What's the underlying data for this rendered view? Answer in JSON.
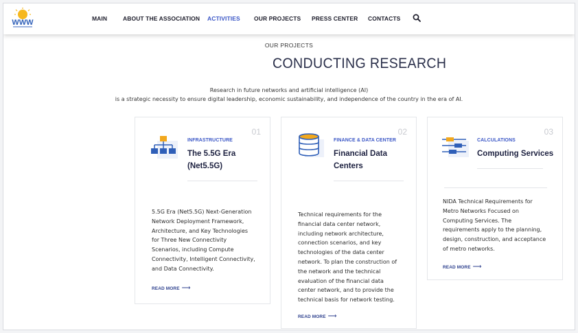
{
  "nav": {
    "items": [
      {
        "label": "MAIN",
        "active": false
      },
      {
        "label": "ABOUT THE ASSOCIATION",
        "active": false
      },
      {
        "label": "ACTIVITIES",
        "active": true
      },
      {
        "label": "OUR PROJECTS",
        "active": false
      },
      {
        "label": "PRESS CENTER",
        "active": false
      },
      {
        "label": "CONTACTS",
        "active": false
      }
    ],
    "search_icon": "search-icon",
    "logo_icon": "sun-logo-icon"
  },
  "header": {
    "kicker": "OUR PROJECTS",
    "title": "CONDUCTING RESEARCH",
    "intro_line1": "Research in future networks and artificial intelligence (AI)",
    "intro_line2": "is a strategic necessity to ensure digital leadership, economic sustainability, and independence of the country in the era of AI."
  },
  "cards": [
    {
      "number": "01",
      "category": "INFRASTRUCTURE",
      "title_line1": "The 5.5G Era",
      "title_line2": "(Net5.5G)",
      "icon": "network-hierarchy-icon",
      "desc_lines": [
        "5.5G Era (Net5.5G) Next-Generation",
        "Network Deployment Framework,",
        "Architecture, and Key Technologies",
        "for Three New Connectivity",
        "Scenarios, including Compute",
        "Connectivity, Intelligent Connectivity,",
        "and Data Connectivity."
      ],
      "read_more": "READ MORE"
    },
    {
      "number": "02",
      "category": "FINANCE & DATA CENTER",
      "title_line1": "Financial Data",
      "title_line2": "Centers",
      "icon": "database-icon",
      "desc_lines": [
        "Technical requirements for the",
        "financial data center network,",
        "including network architecture,",
        "connection scenarios, and key",
        "technologies of the data center",
        "network. To plan the construction of",
        "the network and the technical",
        "evaluation of the financial data",
        "center network, and to provide the",
        "technical basis for network testing."
      ],
      "read_more": "READ MORE"
    },
    {
      "number": "03",
      "category": "CALCULATIONS",
      "title_line1": "Computing Services",
      "title_line2": "",
      "icon": "sliders-icon",
      "desc_lines": [
        "NIDA Technical Requirements for",
        "Metro Networks Focused on",
        "Computing Services. The",
        "requirements apply to the planning,",
        "design, construction, and acceptance",
        "of metro networks."
      ],
      "read_more": "READ MORE"
    }
  ],
  "colors": {
    "accent": "#3a56c6",
    "title": "#2a2f4a",
    "icon_blue": "#2f5fb8",
    "icon_orange": "#f2a81d"
  }
}
